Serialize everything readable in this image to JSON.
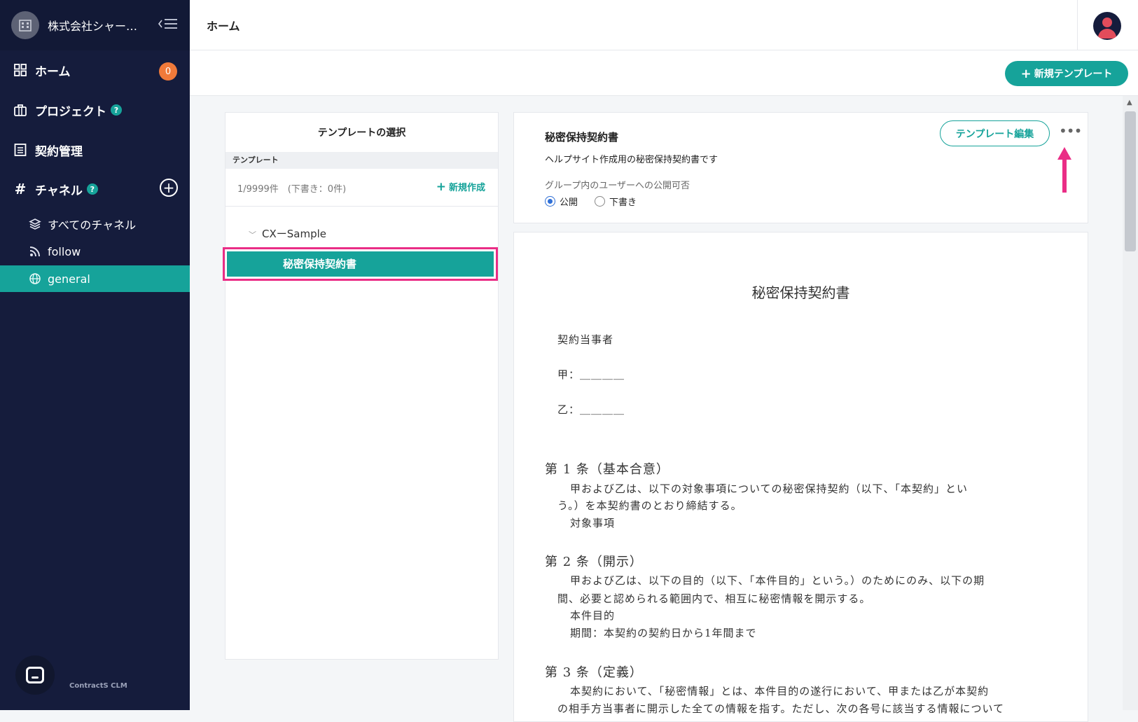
{
  "sidebar": {
    "org_name": "株式会社シャー…",
    "nav": {
      "home": "ホーム",
      "home_badge": "0",
      "project": "プロジェクト",
      "contracts": "契約管理",
      "channel": "チャネル",
      "help": "?"
    },
    "channels": {
      "all": "すべてのチャネル",
      "follow": "follow",
      "general": "general"
    },
    "brand": "ContractS CLM"
  },
  "header": {
    "title": "ホーム"
  },
  "toolbar": {
    "new_template": "新規テンプレート"
  },
  "template_panel": {
    "title": "テンプレートの選択",
    "section": "テンプレート",
    "count": "1/9999件　(下書き：0件)",
    "new_label": "新規作成",
    "group": "CXーSample",
    "selected": "秘密保持契約書"
  },
  "detail": {
    "name": "秘密保持契約書",
    "description": "ヘルプサイト作成用の秘密保持契約書です",
    "publish_label": "グループ内のユーザーへの公開可否",
    "option_public": "公開",
    "option_draft": "下書き",
    "edit_button": "テンプレート編集",
    "more": "•••"
  },
  "document": {
    "title": "秘密保持契約書",
    "parties": "契約当事者",
    "party_a": "甲：＿＿＿＿",
    "party_b": "乙：＿＿＿＿",
    "a1_heading": "第 1 条（基本合意）",
    "a1_l1": "甲および乙は、以下の対象事項についての秘密保持契約（以下、「本契約」とい",
    "a1_l2": "う。）を本契約書のとおり締結する。",
    "a1_l3": "対象事項",
    "a2_heading": "第 2 条（開示）",
    "a2_l1": "甲および乙は、以下の目的（以下、「本件目的」という。）のためにのみ、以下の期",
    "a2_l2": "間、必要と認められる範囲内で、相互に秘密情報を開示する。",
    "a2_l3": "本件目的",
    "a2_l4": "期間：本契約の契約日から1年間まで",
    "a3_heading": "第 3 条（定義）",
    "a3_l1": "本契約において、「秘密情報」とは、本件目的の遂行において、甲または乙が本契約",
    "a3_l2": "の相手方当事者に開示した全ての情報を指す。ただし、次の各号に該当する情報について"
  }
}
